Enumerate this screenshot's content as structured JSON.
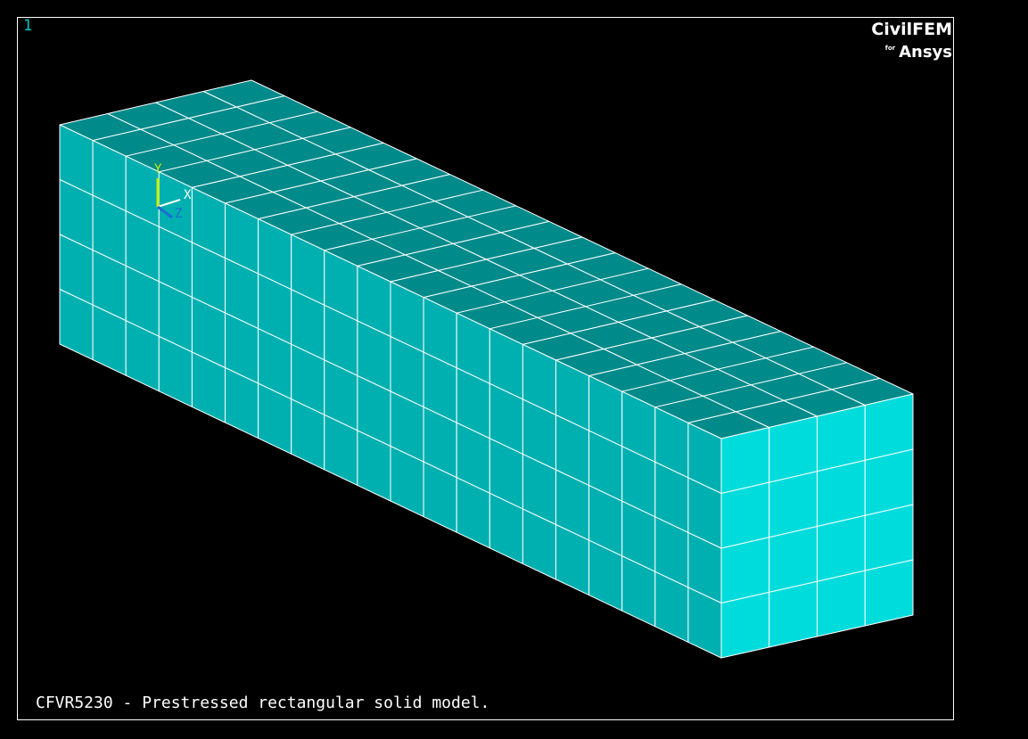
{
  "window_number": "1",
  "logo": {
    "brand": "CivilFEM",
    "connector": "for",
    "product": "Ansys"
  },
  "caption": "CFVR5230 - Prestressed rectangular solid model.",
  "triad": {
    "labels": {
      "x": "X",
      "y": "Y",
      "z": "Z"
    }
  },
  "colors": {
    "background": "#000000",
    "border": "#ffffff",
    "mesh_lines": "#ffffff",
    "top_face": "#008a8a",
    "side_face": "#00b0b0",
    "end_face": "#00dcdc",
    "window_number": "#00c8c8",
    "axis_x": "#ffffff",
    "axis_y": "#c8f000",
    "axis_z": "#1e6cd2"
  },
  "model": {
    "type": "prestressed rectangular solid",
    "mesh": {
      "length_divisions": 20,
      "width_divisions": 4,
      "height_divisions": 4
    }
  }
}
